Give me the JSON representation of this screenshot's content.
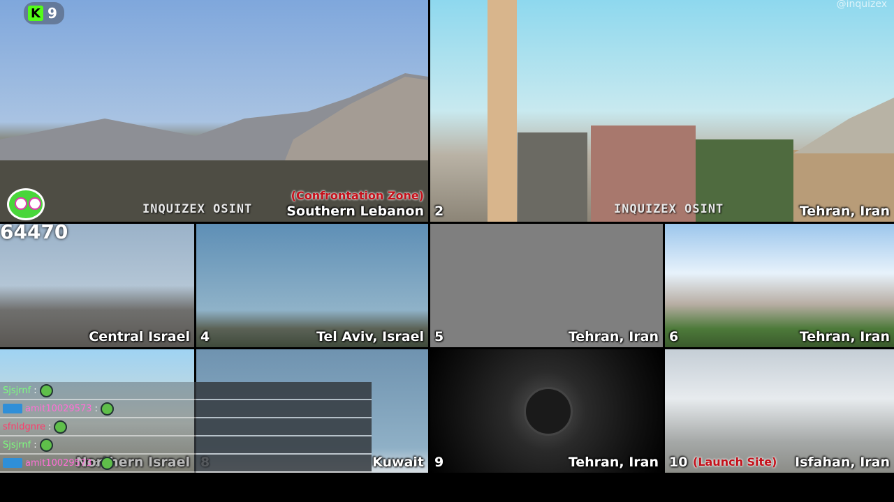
{
  "app": {
    "platform_badge": "K",
    "viewer_count": "9",
    "follower_counter": "64470",
    "top_right_watermark": "@inquizex"
  },
  "colors": {
    "platform_green": "#53fc18",
    "alert_red": "#c4101a"
  },
  "cameras": {
    "cam1": {
      "location": "Southern Lebanon",
      "tag": "(Confrontation Zone)",
      "watermark": "INQUIZEX OSINT"
    },
    "cam2": {
      "number": "2",
      "location": "Tehran, Iran",
      "watermark": "INQUIZEX OSINT"
    },
    "cam3": {
      "location": "Central Israel"
    },
    "cam4": {
      "number": "4",
      "location": "Tel Aviv, Israel"
    },
    "cam5": {
      "number": "5",
      "location": "Tehran, Iran"
    },
    "cam6": {
      "number": "6",
      "location": "Tehran, Iran"
    },
    "cam7": {
      "location": "Northern Israel"
    },
    "cam8": {
      "number": "8",
      "location": "Kuwait"
    },
    "cam9": {
      "number": "9",
      "location": "Tehran, Iran"
    },
    "cam10": {
      "number": "10",
      "tag": "(Launch Site)",
      "location": "Isfahan, Iran"
    }
  },
  "chat": [
    {
      "user": "Sjsjrnf",
      "color": "#7dff7d",
      "badge": false
    },
    {
      "user": "amit10029573",
      "color": "#ff6fd6",
      "badge": true
    },
    {
      "user": "sfnldgnre",
      "color": "#ff3b6b",
      "badge": false
    },
    {
      "user": "Sjsjrnf",
      "color": "#7dff7d",
      "badge": false
    },
    {
      "user": "amit10029573",
      "color": "#ff6fd6",
      "badge": true
    }
  ]
}
